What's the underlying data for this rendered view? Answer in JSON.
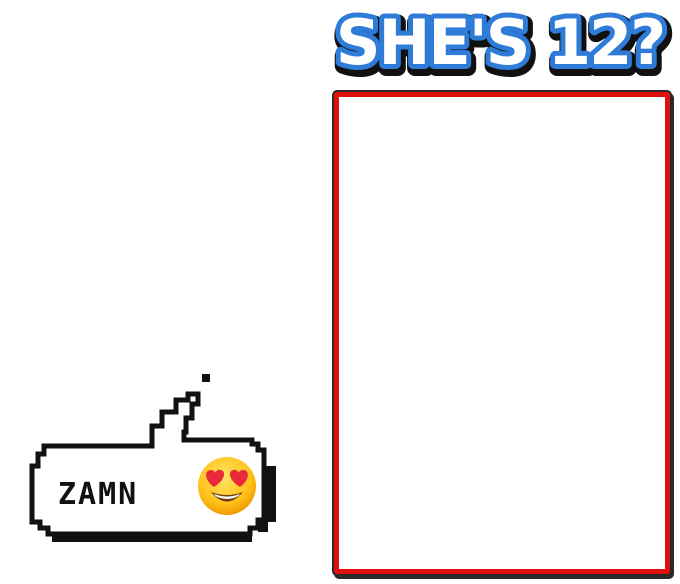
{
  "meme": {
    "title": "SHE'S 12?",
    "bubble_text": "ZAMN",
    "emoji": "heart-eyes-emoji"
  },
  "colors": {
    "title_fill": "#ffffff",
    "title_outline": "#2e7bd8",
    "title_shadow": "#111111",
    "frame_border": "#e01010",
    "bubble_outline": "#111111"
  }
}
